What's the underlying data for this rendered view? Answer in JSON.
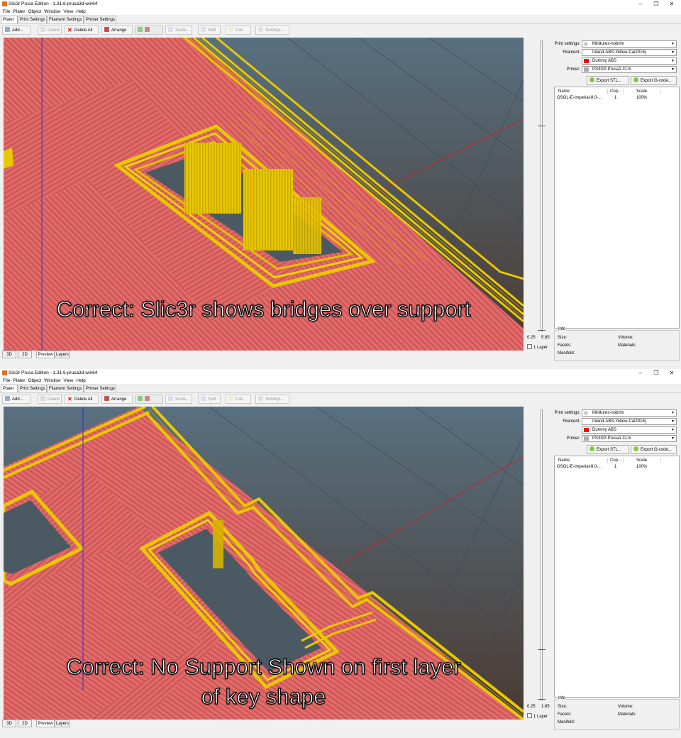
{
  "windows": [
    {
      "title": "Slic3r Prusa Edition - 1.31.6-prusa3d-win64",
      "menu": [
        "File",
        "Plater",
        "Object",
        "Window",
        "View",
        "Help"
      ],
      "tabs": [
        "Plater",
        "Print Settings",
        "Filament Settings",
        "Printer Settings"
      ],
      "toolbar": {
        "add": "Add...",
        "delete": "Delete",
        "delete_all": "Delete All",
        "arrange": "Arrange",
        "scale": "Scale...",
        "split": "Split",
        "cut": "Cut...",
        "settings": "Settings..."
      },
      "overlay": "Correct:  Slic3r shows bridges over support",
      "slider": {
        "min": "0.25",
        "max": "5.85",
        "one_layer": "1 Layer"
      },
      "bottom_tabs": [
        "3D",
        "2D",
        "Preview",
        "Layers"
      ],
      "presets": {
        "print_label": "Print settings:",
        "print": "Minitures-nobrim",
        "filament_label": "Filament:",
        "filament": "Inland-ABS-Yellow-Cal2016]",
        "filament2": "Dummy ABS",
        "printer_label": "Printer:",
        "printer": "PS3DP-Prusa1.31.6"
      },
      "export": {
        "stl": "Export STL...",
        "gcode": "Export G-code..."
      },
      "objects": {
        "columns": [
          "Name",
          "Cop...",
          "Scale"
        ],
        "rows": [
          {
            "name": "OSOL-E-Imperial-8.0-...",
            "copies": "1",
            "scale": "100%"
          }
        ]
      },
      "info": {
        "title": "Info",
        "size": "Size:",
        "volume": "Volume:",
        "facets": "Facets:",
        "materials": "Materials:",
        "manifold": "Manifold:"
      }
    },
    {
      "title": "Slic3r Prusa Edition - 1.31.6-prusa3d-win64",
      "menu": [
        "File",
        "Plater",
        "Object",
        "Window",
        "View",
        "Help"
      ],
      "tabs": [
        "Plater",
        "Print Settings",
        "Filament Settings",
        "Printer Settings"
      ],
      "toolbar": {
        "add": "Add...",
        "delete": "Delete",
        "delete_all": "Delete All",
        "arrange": "Arrange",
        "scale": "Scale...",
        "split": "Split",
        "cut": "Cut...",
        "settings": "Settings..."
      },
      "overlay": "Correct:  No Support Shown on first layer\nof key shape",
      "slider": {
        "min": "0.25",
        "max": "1.65",
        "one_layer": "1 Layer"
      },
      "bottom_tabs": [
        "3D",
        "2D",
        "Preview",
        "Layers"
      ],
      "presets": {
        "print_label": "Print settings:",
        "print": "Minitures-nobrim",
        "filament_label": "Filament:",
        "filament": "Inland-ABS-Yellow-Cal2016]",
        "filament2": "Dummy ABS",
        "printer_label": "Printer:",
        "printer": "PS3DP-Prusa1.31.6"
      },
      "export": {
        "stl": "Export STL...",
        "gcode": "Export G-code..."
      },
      "objects": {
        "columns": [
          "Name",
          "Cop...",
          "Scale"
        ],
        "rows": [
          {
            "name": "OSOL-E-Imperial-8.0-...",
            "copies": "1",
            "scale": "100%"
          }
        ]
      },
      "info": {
        "title": "Info",
        "size": "Size:",
        "volume": "Volume:",
        "facets": "Facets:",
        "materials": "Materials:",
        "manifold": "Manifold:"
      }
    }
  ],
  "colors": {
    "infill": "#e06666",
    "perimeter": "#e6c600",
    "background_top": "#5a7080",
    "background_bottom": "#4a3a30",
    "filament_swatch": "#ff0000"
  },
  "icons": {
    "add": "add-icon",
    "delete": "delete-icon",
    "delete_all": "red-x-icon",
    "arrange": "arrange-icon",
    "export_stl": "export-icon",
    "export_gcode": "export-icon"
  }
}
